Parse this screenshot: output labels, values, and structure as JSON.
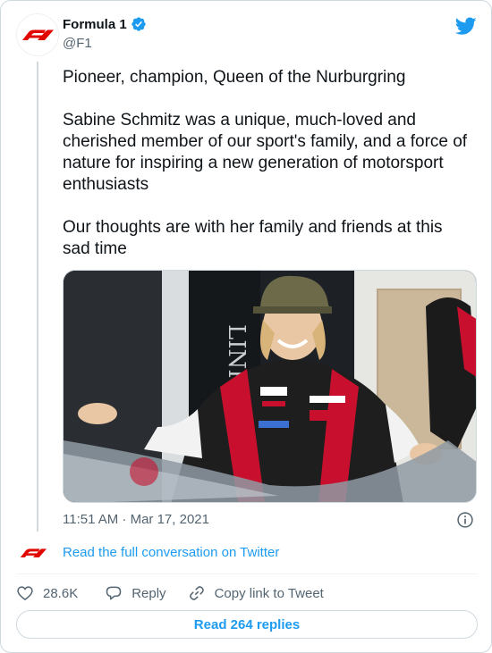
{
  "author": {
    "display_name": "Formula 1",
    "handle": "@F1",
    "avatar_icon": "f1-logo-icon",
    "verified_icon": "verified-badge-icon"
  },
  "brand_icon": "twitter-bird-icon",
  "tweet": {
    "paragraphs": [
      "Pioneer, champion, Queen of the Nurburgring",
      "Sabine Schmitz was a unique, much-loved and cherished member of our sport's family, and a force of nature for inspiring a new generation of motorsport enthusiasts",
      "Our thoughts are with her family and friends at this sad time"
    ],
    "timestamp": "11:51 AM · Mar 17, 2021",
    "info_icon": "info-icon"
  },
  "conversation": {
    "link_text": "Read the full conversation on Twitter"
  },
  "actions": {
    "likes": "28.6K",
    "reply_label": "Reply",
    "copy_link_label": "Copy link to Tweet",
    "like_icon": "heart-icon",
    "reply_icon": "reply-bubble-icon",
    "copy_icon": "link-icon"
  },
  "replies_button": "Read 264 replies",
  "colors": {
    "accent": "#1d9bf0",
    "f1_red": "#e10600",
    "muted": "#536471",
    "border": "#cfd9de"
  }
}
